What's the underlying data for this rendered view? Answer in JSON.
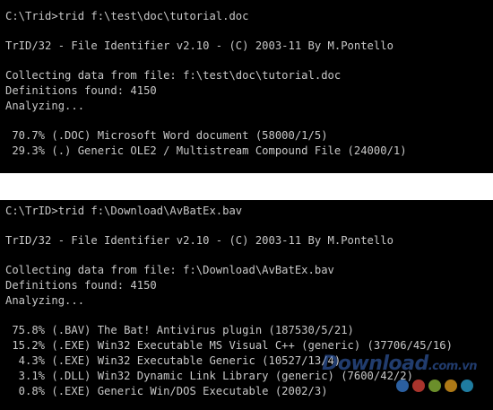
{
  "console1": {
    "lines": [
      "C:\\Trid>trid f:\\test\\doc\\tutorial.doc",
      "",
      "TrID/32 - File Identifier v2.10 - (C) 2003-11 By M.Pontello",
      "",
      "Collecting data from file: f:\\test\\doc\\tutorial.doc",
      "Definitions found: 4150",
      "Analyzing...",
      "",
      " 70.7% (.DOC) Microsoft Word document (58000/1/5)",
      " 29.3% (.) Generic OLE2 / Multistream Compound File (24000/1)"
    ]
  },
  "console2": {
    "lines": [
      "C:\\TrID>trid f:\\Download\\AvBatEx.bav",
      "",
      "TrID/32 - File Identifier v2.10 - (C) 2003-11 By M.Pontello",
      "",
      "Collecting data from file: f:\\Download\\AvBatEx.bav",
      "Definitions found: 4150",
      "Analyzing...",
      "",
      " 75.8% (.BAV) The Bat! Antivirus plugin (187530/5/21)",
      " 15.2% (.EXE) Win32 Executable MS Visual C++ (generic) (37706/45/16)",
      "  4.3% (.EXE) Win32 Executable Generic (10527/13/4)",
      "  3.1% (.DLL) Win32 Dynamic Link Library (generic) (7600/42/2)",
      "  0.8% (.EXE) Generic Win/DOS Executable (2002/3)"
    ]
  },
  "watermark": {
    "text": "Download",
    "suffix": ".com.vn",
    "dot_colors": [
      "#3a7fd5",
      "#e2463b",
      "#8fbf3a",
      "#e8a21d",
      "#2aa6d6"
    ]
  },
  "colors": {
    "background": "#000000",
    "text": "#c8c8c8",
    "separator": "#ffffff"
  }
}
